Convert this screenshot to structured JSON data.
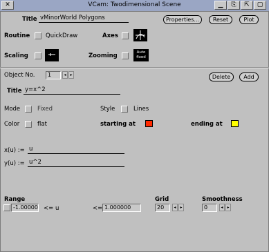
{
  "window": {
    "title": "VCam: Twodimensional Scene",
    "close_glyph": "✕",
    "minimize_glyph": "▁",
    "restore_glyph": "⎘",
    "maximize_glyph": "⇱",
    "iconify_glyph": "▢"
  },
  "scene": {
    "title_label": "Title",
    "title_value": "vMinorWorld Polygons",
    "properties_button": "Properties...",
    "reset_button": "Reset",
    "plot_button": "Plot",
    "routine_label": "Routine",
    "routine_value": "QuickDraw",
    "axes_label": "Axes",
    "scaling_label": "Scaling",
    "zooming_label": "Zooming",
    "zoom_icon_text": "Auto\nfixed"
  },
  "object": {
    "object_label": "Object No.",
    "object_number": "1",
    "delete_button": "Delete",
    "add_button": "Add",
    "title_label": "Title",
    "title_value": "y=x^2",
    "mode_label": "Mode",
    "mode_value": "Fixed",
    "style_label": "Style",
    "style_value": "Lines",
    "color_label": "Color",
    "color_value": "flat",
    "starting_label": "starting at",
    "ending_label": "ending at",
    "start_color": "#ff2a00",
    "end_color": "#ffff00",
    "x_label": "x(u) :=",
    "x_value": "u",
    "y_label": "y(u) :=",
    "y_value": "u^2"
  },
  "range": {
    "range_label": "Range",
    "min_value": "-1.000000",
    "lte_left": "<= u",
    "lte_right": "<=",
    "max_value": "1.000000",
    "grid_label": "Grid",
    "grid_value": "20",
    "smoothness_label": "Smoothness",
    "smoothness_value": "0"
  }
}
